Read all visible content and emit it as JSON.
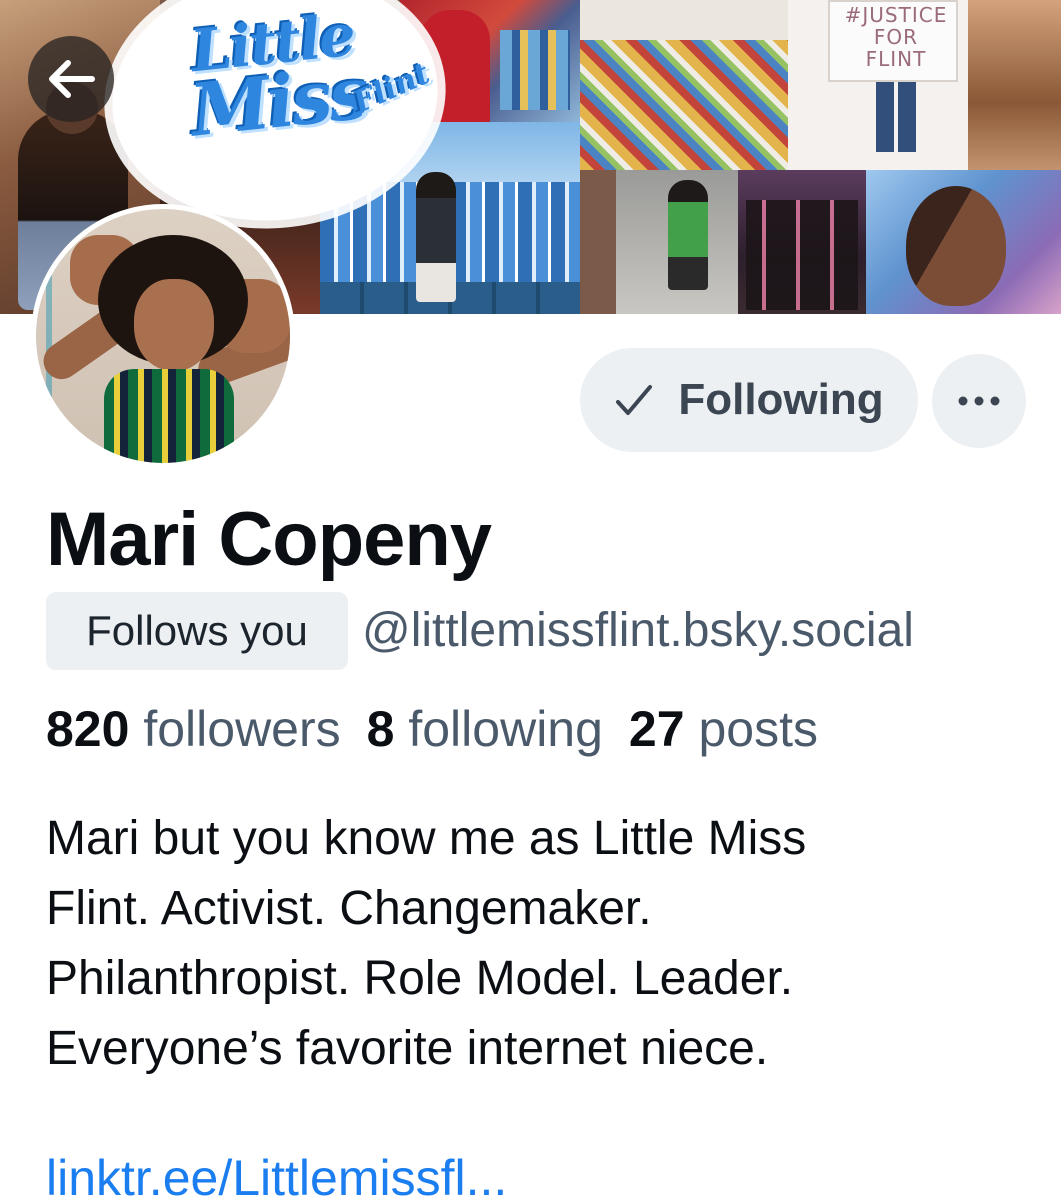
{
  "banner": {
    "logo": {
      "line1": "Little",
      "line2": "Miss",
      "line3": "Flint"
    },
    "sign_text": [
      "#JUSTICE",
      "FOR",
      "FLINT"
    ]
  },
  "nav": {
    "back_icon": "arrow-left-icon"
  },
  "actions": {
    "following_label": "Following",
    "following_icon": "checkmark-icon",
    "more_icon": "ellipsis-icon"
  },
  "profile": {
    "display_name": "Mari Copeny",
    "follows_you_label": "Follows you",
    "handle": "@littlemissflint.bsky.social",
    "stats": {
      "followers_count": "820",
      "followers_label": "followers",
      "following_count": "8",
      "following_label": "following",
      "posts_count": "27",
      "posts_label": "posts"
    },
    "bio_lines": [
      "Mari but you know me as Little Miss",
      "Flint. Activist. Changemaker.",
      "Philanthropist. Role Model. Leader.",
      "Everyone’s favorite internet niece."
    ],
    "link": "linktr.ee/Littlemissfl..."
  },
  "colors": {
    "accent_link": "#1a7df0",
    "button_bg": "#edf0f3",
    "muted_text": "#4b5a6b",
    "primary_text": "#0b0f14",
    "logo_blue": "#2f86df"
  }
}
